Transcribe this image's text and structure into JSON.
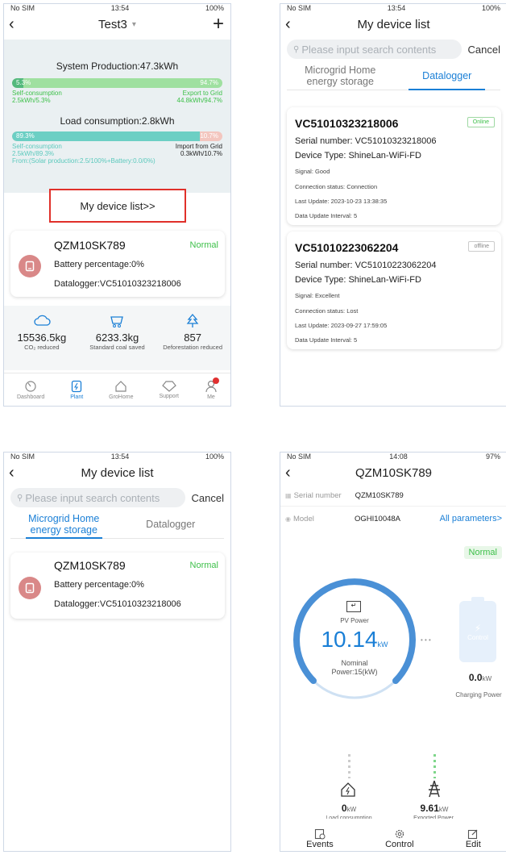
{
  "status": {
    "carrier": "No SIM",
    "time1": "13:54",
    "time4": "14:08",
    "battery1": "100%",
    "battery4": "97%"
  },
  "screen1": {
    "title": "Test3",
    "system_production": "System Production:47.3kWh",
    "prod_bar": {
      "left": "5.3%",
      "right": "94.7%",
      "left_fraction": 0.053
    },
    "self_consumption": "Self-consumption",
    "self_value": "2.5kWh/5.3%",
    "export_label": "Export to Grid",
    "export_value": "44.8kWh/94.7%",
    "load_consumption": "Load consumption:2.8kWh",
    "load_bar": {
      "left": "89.3%",
      "right": "10.7%",
      "left_fraction": 0.893
    },
    "self_value2": "2.5kWh/89.3%",
    "import_label": "Import from Grid",
    "import_value": "0.3kWh/10.7%",
    "from_note": "From:(Solar production:2.5/100%+Battery:0.0/0%)",
    "device_list_link": "My device list>>",
    "device_name": "QZM10SK789",
    "device_status": "Normal",
    "battery_pct": "Battery percentage:0%",
    "datalogger": "Datalogger:VC51010323218006",
    "stats": [
      {
        "value": "15536.5kg",
        "label": "CO₂ reduced",
        "icon": "co2-cloud-icon"
      },
      {
        "value": "6233.3kg",
        "label": "Standard coal saved",
        "icon": "coal-cart-icon"
      },
      {
        "value": "857",
        "label": "Deforestation reduced",
        "icon": "tree-icon"
      }
    ],
    "bottom_nav": [
      "Dashboard",
      "Plant",
      "GroHome",
      "Support",
      "Me"
    ]
  },
  "screen2": {
    "title": "My device list",
    "search_placeholder": "Please input search contents",
    "cancel": "Cancel",
    "tab1_line1": "Microgrid Home",
    "tab1_line2": "energy storage",
    "tab2": "Datalogger",
    "loggers": [
      {
        "name": "VC51010323218006",
        "status": "Online",
        "serial": "Serial number: VC51010323218006",
        "type": "Device Type: ShineLan-WiFi-FD",
        "signal": "Signal: Good",
        "conn": "Connection status: Connection",
        "update": "Last Update: 2023-10-23 13:38:35",
        "interval": "Data Update Interval: 5"
      },
      {
        "name": "VC51010223062204",
        "status": "offline",
        "serial": "Serial number: VC51010223062204",
        "type": "Device Type: ShineLan-WiFi-FD",
        "signal": "Signal: Excellent",
        "conn": "Connection status: Lost",
        "update": "Last Update: 2023-09-27 17:59:05",
        "interval": "Data Update Interval: 5"
      }
    ]
  },
  "screen3": {
    "title": "My device list",
    "search_placeholder": "Please input search contents",
    "cancel": "Cancel",
    "tab1_line1": "Microgrid Home",
    "tab1_line2": "energy storage",
    "tab2": "Datalogger",
    "device_name": "QZM10SK789",
    "device_status": "Normal",
    "battery_pct": "Battery percentage:0%",
    "datalogger": "Datalogger:VC51010323218006"
  },
  "screen4": {
    "title": "QZM10SK789",
    "serial_label": "Serial number",
    "serial_value": "QZM10SK789",
    "model_label": "Model",
    "model_value": "OGHI10048A",
    "all_params": "All parameters>",
    "status": "Normal",
    "pv_label": "PV Power",
    "pv_value": "10.14",
    "pv_unit": "kW",
    "nominal_line1": "Nominal",
    "nominal_line2": "Power:15(kW)",
    "dots": "• • •",
    "battery_label": "Control",
    "charging_value": "0.0",
    "charging_unit": "kW",
    "charging_label": "Charging Power",
    "load_value": "0",
    "load_unit": "kW",
    "load_label": "Load consumption",
    "export_value": "9.61",
    "export_unit": "kW",
    "export_label": "Exported Power",
    "bottom": [
      "Events",
      "Control",
      "Edit"
    ]
  }
}
